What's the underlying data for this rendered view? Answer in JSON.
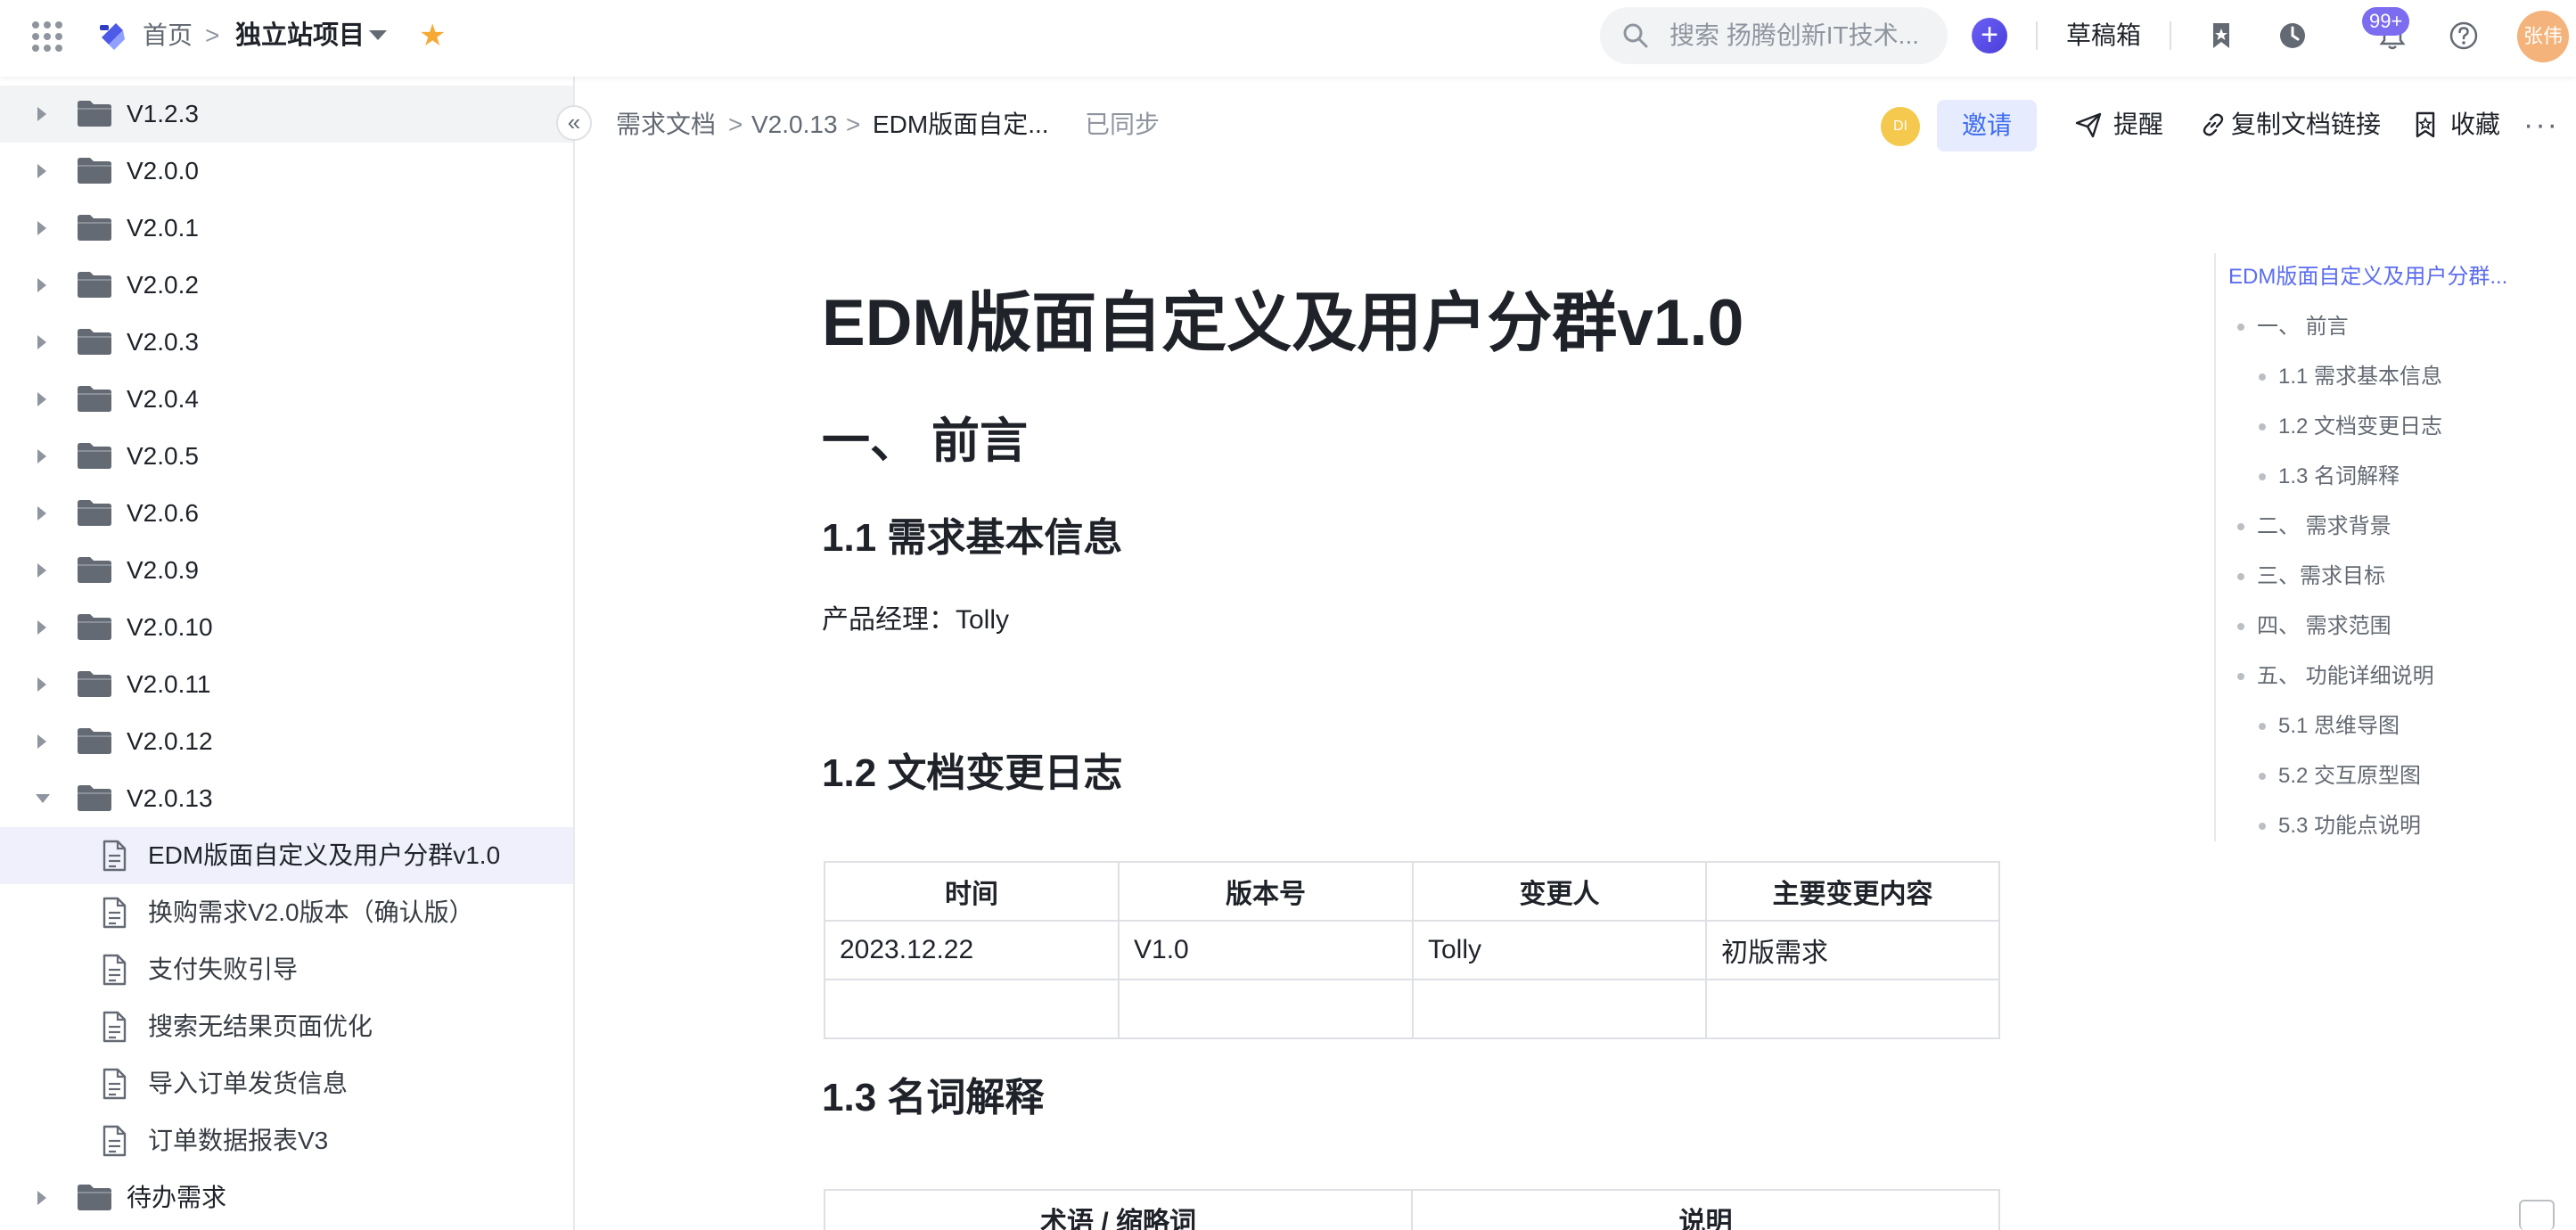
{
  "topbar": {
    "home": "首页",
    "separator": ">",
    "project": "独立站项目",
    "search_placeholder": "搜索 扬腾创新IT技术...",
    "drafts": "草稿箱",
    "notification_badge": "99+",
    "user_avatar": "张伟"
  },
  "sidebar": {
    "folders_top": [
      {
        "label": "V1.2.3"
      },
      {
        "label": "V2.0.0"
      },
      {
        "label": "V2.0.1"
      },
      {
        "label": "V2.0.2"
      },
      {
        "label": "V2.0.3"
      },
      {
        "label": "V2.0.4"
      },
      {
        "label": "V2.0.5"
      },
      {
        "label": "V2.0.6"
      },
      {
        "label": "V2.0.9"
      },
      {
        "label": "V2.0.10"
      },
      {
        "label": "V2.0.11"
      },
      {
        "label": "V2.0.12"
      }
    ],
    "expanded_folder": {
      "label": "V2.0.13"
    },
    "docs": [
      {
        "label": "EDM版面自定义及用户分群v1.0"
      },
      {
        "label": "换购需求V2.0版本（确认版）"
      },
      {
        "label": "支付失败引导"
      },
      {
        "label": "搜索无结果页面优化"
      },
      {
        "label": "导入订单发货信息"
      },
      {
        "label": "订单数据报表V3"
      }
    ],
    "folder_bottom": {
      "label": "待办需求"
    }
  },
  "breadcrumb": {
    "items": [
      "需求文档",
      "V2.0.13",
      "EDM版面自定..."
    ],
    "sep": ">",
    "status": "已同步"
  },
  "doc_actions": {
    "collaborator_avatar": "DI",
    "invite": "邀请",
    "remind": "提醒",
    "copy_link": "复制文档链接",
    "favorite": "收藏",
    "more": "···"
  },
  "doc": {
    "title": "EDM版面自定义及用户分群v1.0",
    "h1_preface": "一、 前言",
    "h2_basic": "1.1 需求基本信息",
    "pm_line": "产品经理：Tolly",
    "h2_changelog": "1.2 文档变更日志",
    "changelog_table": {
      "headers": [
        "时间",
        "版本号",
        "变更人",
        "主要变更内容"
      ],
      "rows": [
        [
          "2023.12.22",
          "V1.0",
          "Tolly",
          "初版需求"
        ],
        [
          "",
          "",
          "",
          ""
        ]
      ]
    },
    "h2_glossary": "1.3 名词解释",
    "glossary_table": {
      "headers": [
        "术语 / 缩略词",
        "说明"
      ]
    }
  },
  "outline": {
    "items": [
      {
        "label": "EDM版面自定义及用户分群...",
        "level": 0,
        "active": true
      },
      {
        "label": "一、 前言",
        "level": 1
      },
      {
        "label": "1.1 需求基本信息",
        "level": 2
      },
      {
        "label": "1.2 文档变更日志",
        "level": 2
      },
      {
        "label": "1.3 名词解释",
        "level": 2
      },
      {
        "label": "二、 需求背景",
        "level": 1
      },
      {
        "label": "三、需求目标",
        "level": 1
      },
      {
        "label": "四、 需求范围",
        "level": 1
      },
      {
        "label": "五、 功能详细说明",
        "level": 1
      },
      {
        "label": "5.1 思维导图",
        "level": 2
      },
      {
        "label": "5.2 交互原型图",
        "level": 2
      },
      {
        "label": "5.3 功能点说明",
        "level": 2
      }
    ]
  },
  "colors": {
    "accent": "#5b6cf0",
    "star": "#f7a936",
    "active_row": "#eff0fb",
    "folder": "#646a73"
  }
}
